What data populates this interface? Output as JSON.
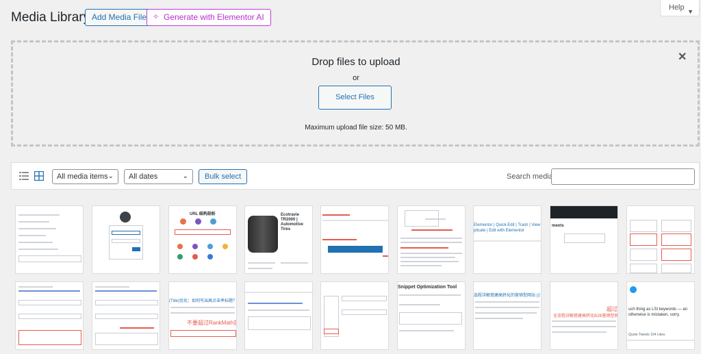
{
  "header": {
    "title": "Media Library",
    "add_media_label": "Add Media File",
    "ai_label": "Generate with Elementor AI",
    "help_label": "Help"
  },
  "upload": {
    "drop_title": "Drop files to upload",
    "or_text": "or",
    "select_files_label": "Select Files",
    "max_size": "Maximum upload file size: 50 MB."
  },
  "toolbar": {
    "filter_type": "All media items",
    "filter_date": "All dates",
    "bulk_select_label": "Bulk select",
    "search_label": "Search media",
    "search_value": ""
  },
  "thumb_text": {
    "t3": "URL 结构剖析",
    "t4": "Ecotravie TR2000 | Automotive Tires",
    "t8": "Elementor | Quick Edit | Trash | View | Clear\nplicate | Edit with Elementor",
    "t9": "ments",
    "t13": "(Title)优化：如何写出高点击率标题？(",
    "t13b": "不要超过RankMath提",
    "t15": "Snippet Optimization Tool",
    "t17": "选程详解搭建高转化的营销型网站 (2",
    "t18": "全流程详解搭建高转化B2B营销型网",
    "t18b": "超过",
    "t19": "uch thing as LSI keywords — an\notherwise is mistaken, sorry.",
    "t19b": "Quote Tweets   104 Likes"
  },
  "icons": [
    "list-view-icon",
    "grid-view-icon",
    "close-icon",
    "sparkle-icon",
    "caret-down-icon",
    "chevron-down-icon"
  ],
  "colors": {
    "accent": "#2271b1",
    "ai": "#c138d8",
    "bg": "#f0f0f1"
  }
}
